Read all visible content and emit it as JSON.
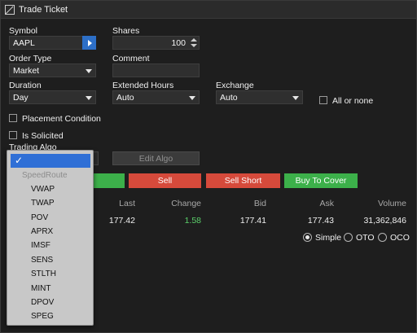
{
  "window": {
    "title": "Trade Ticket"
  },
  "form": {
    "symbol_label": "Symbol",
    "symbol_value": "AAPL",
    "shares_label": "Shares",
    "shares_value": "100",
    "order_type_label": "Order Type",
    "order_type_value": "Market",
    "comment_label": "Comment",
    "comment_value": "",
    "duration_label": "Duration",
    "duration_value": "Day",
    "extended_hours_label": "Extended Hours",
    "extended_hours_value": "Auto",
    "exchange_label": "Exchange",
    "exchange_value": "Auto",
    "all_or_none_label": "All or none",
    "placement_condition_label": "Placement Condition",
    "is_solicited_label": "Is Solicited",
    "trading_algo_label": "Trading Algo",
    "edit_algo_label": "Edit Algo"
  },
  "order_buttons": {
    "sell": "Sell",
    "sell_short": "Sell Short",
    "buy_to_cover": "Buy To Cover"
  },
  "quote": {
    "headers": {
      "last": "Last",
      "change": "Change",
      "bid": "Bid",
      "ask": "Ask",
      "volume": "Volume"
    },
    "values": {
      "last": "177.42",
      "change": "1.58",
      "bid": "177.41",
      "ask": "177.43",
      "volume": "31,362,846"
    }
  },
  "order_mode": {
    "options": [
      "Simple",
      "OTO",
      "OCO"
    ],
    "selected": "Simple"
  },
  "algo_dropdown": {
    "selected_glyph": "✓",
    "group_header": "SpeedRoute",
    "items": [
      "VWAP",
      "TWAP",
      "POV",
      "APRX",
      "IMSF",
      "SENS",
      "STLTH",
      "MINT",
      "DPOV",
      "SPEG"
    ]
  },
  "colors": {
    "buy_green": "#3cb04a",
    "sell_red": "#d64a3b",
    "accent_blue": "#2f6fd6",
    "change_positive": "#5bd06a"
  }
}
